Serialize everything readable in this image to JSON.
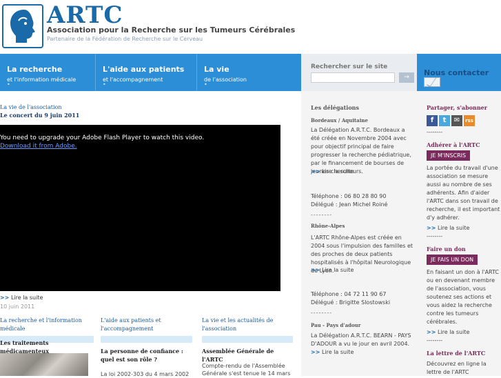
{
  "header": {
    "brand": "ARTC",
    "subtitle": "Association pour la Recherche sur les Tumeurs Cérébrales",
    "tagline": "Partenaire de la Fédération de Recherche sur le Cerveau"
  },
  "nav": {
    "items": [
      {
        "title": "La recherche",
        "sub": "et l'information médicale",
        "dot": "•"
      },
      {
        "title": "L'aide aux patients",
        "sub": "et l'accompagnement",
        "dot": "•"
      },
      {
        "title": "La vie",
        "sub": "de l'association",
        "dot": "•"
      }
    ],
    "search_label": "Rechercher sur le site",
    "search_placeholder": "",
    "search_button": "→",
    "contact": "Nous contacter"
  },
  "main": {
    "breadcrumb": "La vie de l'association",
    "title": "Le concert du 9 juin 2011",
    "flash_msg": "You need to upgrade your Adobe Flash Player to watch this video.",
    "flash_link": "Download it from Adobe.",
    "more_arrow": ">>",
    "more_label": "Lire la suite",
    "date": "10 juin 2011",
    "cols": [
      {
        "title": "La recherche et l'information médicale"
      },
      {
        "title": "L'aide aux patients et l'accompagnement"
      },
      {
        "title": "La vie et les actualités de l'association"
      }
    ],
    "sub1": "Les traitements médicamenteux",
    "sub2": "La personne de confiance : quel est son rôle ?",
    "sub2_text": "La loi 2002-303 du 4 mars 2002",
    "sub3": "Assemblée Générale de l'ARTC",
    "sub3_text": "Compte-rendu de l'Assemblée Générale s'est tenue le 14 mars"
  },
  "delegations": {
    "heading": "Les délégations",
    "dash": "--------",
    "items": [
      {
        "region": "Bordeaux / Aquitaine",
        "text": "La Délégation A.R.T.C. Bordeaux a été créée en Novembre 2004 avec pour objectif principal de faire progresser la recherche pédiatrique, par le financement de bourses de jeunes chercheurs.",
        "more": "Lire la suite",
        "phone": "Téléphone : 06 80 28 80 90",
        "delegate": "Délégué : Jean Michel Roiné"
      },
      {
        "region": "Rhône-Alpes",
        "text": "L'ARTC Rhône-Alpes est créée en 2004 sous l'impulsion des familles et des proches de deux patients hospitalisés à l'hôpital Neurologique de Lyon.",
        "more": "Lire la suite",
        "phone": "Téléphone : 04 72 11 90 67",
        "delegate": "Délégué : Brigitte Slostowski"
      },
      {
        "region": "Pau - Pays d'adour",
        "text": "La Délégation A.R.T.C. BEARN - PAYS D'ADOUR a vu le jour en avril 2004.",
        "more": "Lire la suite"
      }
    ]
  },
  "right": {
    "share_title": "Partager, s'abonner",
    "share_icons": [
      "f",
      "t",
      "✉",
      "rss"
    ],
    "dash": "--------",
    "adherer_title": "Adhérer à l'ARTC",
    "adherer_button": "JE M'INSCRIS",
    "adherer_text": "La portée du travail d'une association se mesure aussi au nombre de ses adhérents. Afin d'aider l'ARTC dans son travail de recherche, il est important d'y adhérer.",
    "adherer_more": "Lire la suite",
    "don_title": "Faire un don",
    "don_button": "JE FAIS UN DON",
    "don_text": "En faisant un don à l'ARTC ou en devenant membre de l'association, vous soutenez ses actions et vous aidez la recherche contre les tumeurs cérébrales.",
    "don_more": "Lire la suite",
    "letter_title": "La lettre de l'ARTC",
    "letter_text": "Découvrez en ligne la lettre de l'ARTC"
  }
}
